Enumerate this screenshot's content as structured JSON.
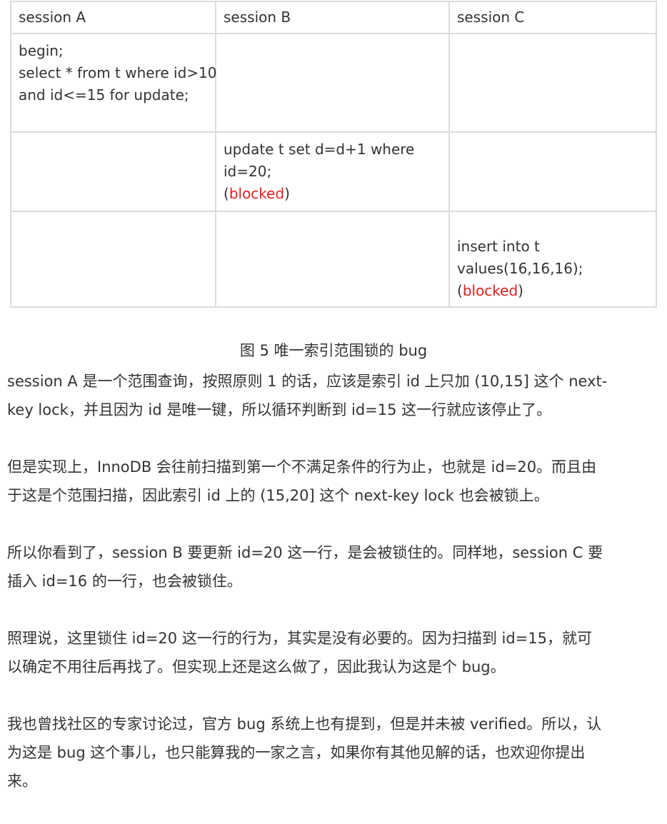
{
  "table": {
    "headers": [
      "session A",
      "session B",
      "session C"
    ],
    "row1": {
      "a_lines": [
        "begin;",
        "select * from t where id>10",
        "and id<=15 for update;"
      ]
    },
    "row2": {
      "b_lines": [
        "update t set d=d+1 where",
        "id=20;"
      ],
      "b_blocked": "blocked"
    },
    "row3": {
      "c_lines": [
        "insert into t",
        "values(16,16,16);"
      ],
      "c_blocked": "blocked"
    },
    "paren_open": "(",
    "paren_close": ")"
  },
  "caption": "图 5 唯一索引范围锁的 bug",
  "paragraphs": [
    [
      "session A 是一个范围查询，按照原则 1 的话，应该是索引 id 上只加 (10,15] 这个 next-",
      "key lock，并且因为 id 是唯一键，所以循环判断到 id=15 这一行就应该停止了。"
    ],
    [
      "但是实现上，InnoDB 会往前扫描到第一个不满足条件的行为止，也就是 id=20。而且由",
      "于这是个范围扫描，因此索引 id 上的 (15,20] 这个 next-key lock 也会被锁上。"
    ],
    [
      "所以你看到了，session B 要更新 id=20 这一行，是会被锁住的。同样地，session C 要",
      "插入 id=16 的一行，也会被锁住。"
    ],
    [
      "照理说，这里锁住 id=20 这一行的行为，其实是没有必要的。因为扫描到 id=15，就可",
      "以确定不用往后再找了。但实现上还是这么做了，因此我认为这是个 bug。"
    ],
    [
      "我也曾找社区的专家讨论过，官方 bug 系统上也有提到，但是并未被 verified。所以，认",
      "为这是 bug 这个事儿，也只能算我的一家之言，如果你有其他见解的话，也欢迎你提出",
      "来。"
    ]
  ]
}
